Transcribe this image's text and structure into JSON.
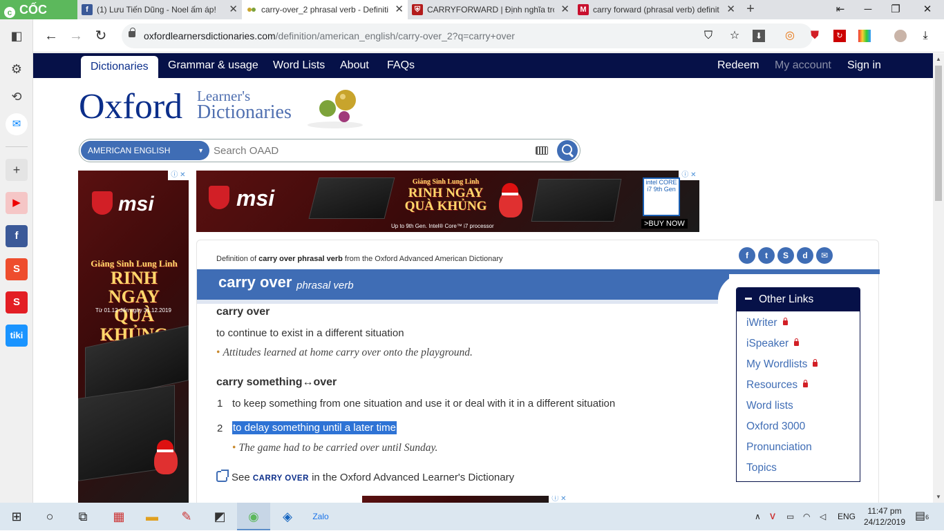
{
  "browser": {
    "brand": "CỐC CỐC",
    "tabs": [
      {
        "title": "(1) Lưu Tiến Dũng - Noel ấm áp!",
        "favicon": "facebook-icon",
        "color": "#3b5998"
      },
      {
        "title": "carry-over_2 phrasal verb - Definiti",
        "favicon": "oxford-balls-icon",
        "color": "#ffffff",
        "active": true
      },
      {
        "title": "CARRYFORWARD | Định nghĩa tron",
        "favicon": "cambridge-shield-icon",
        "color": "#b31b1b"
      },
      {
        "title": "carry forward (phrasal verb) definit",
        "favicon": "macmillan-icon",
        "color": "#c8102e"
      }
    ],
    "url_domain": "oxfordlearnersdictionaries.com",
    "url_path": "/definition/american_english/carry-over_2?q=carry+over"
  },
  "site": {
    "nav": [
      "Dictionaries",
      "Grammar & usage",
      "Word Lists",
      "About",
      "FAQs"
    ],
    "nav_right": [
      "Redeem",
      "My account",
      "Sign in"
    ],
    "logo_main": "Oxford",
    "logo_line1": "Learner's",
    "logo_line2": "Dictionaries"
  },
  "search": {
    "language": "AMERICAN ENGLISH",
    "placeholder": "Search OAAD"
  },
  "ads": {
    "brand": "msi",
    "badge_line1": "Giáng Sinh Lung Linh",
    "badge_line2": "RINH NGAY",
    "badge_line3": "QUÀ KHỦNG",
    "dates": "Từ 01.12 đến ngày 31.12.2019",
    "processor_note": "Up to 9th Gen. Intel® Core™ i7 processor",
    "intel_badge": "intel CORE i7 9th Gen",
    "buy": ">BUY NOW"
  },
  "entry": {
    "defof_prefix": "Definition of ",
    "defof_term": "carry over phrasal verb",
    "defof_suffix": " from the Oxford Advanced American Dictionary",
    "headword": "carry over",
    "pos": "phrasal verb",
    "sense1_phrase": "carry over",
    "sense1_def": "to continue to exist in a different situation",
    "sense1_example": "Attitudes learned at home carry over onto the playground.",
    "sense2_phrase": "carry something↔over",
    "sense2_items": [
      {
        "num": "1",
        "def": "to keep something from one situation and use it or deal with it in a different situation"
      },
      {
        "num": "2",
        "def": "to delay something until a later time",
        "example": "The game had to be carried over until Sunday."
      }
    ],
    "see_prefix": "See ",
    "see_link": "CARRY OVER",
    "see_suffix": " in the Oxford Advanced Learner's Dictionary"
  },
  "other_links": {
    "title": "Other Links",
    "items": [
      {
        "label": "iWriter",
        "locked": true
      },
      {
        "label": "iSpeaker",
        "locked": true
      },
      {
        "label": "My Wordlists",
        "locked": true
      },
      {
        "label": "Resources",
        "locked": true
      },
      {
        "label": "Word lists",
        "locked": false
      },
      {
        "label": "Oxford 3000",
        "locked": false
      },
      {
        "label": "Pronunciation",
        "locked": false
      },
      {
        "label": "Topics",
        "locked": false
      }
    ]
  },
  "taskbar": {
    "lang": "ENG",
    "time": "11:47 pm",
    "date": "24/12/2019",
    "notifications": "6"
  },
  "colors": {
    "oxford_navy": "#061148",
    "oxford_blue": "#3f6db5",
    "selection": "#2e73d5",
    "coccoc_green": "#5cb85c"
  }
}
